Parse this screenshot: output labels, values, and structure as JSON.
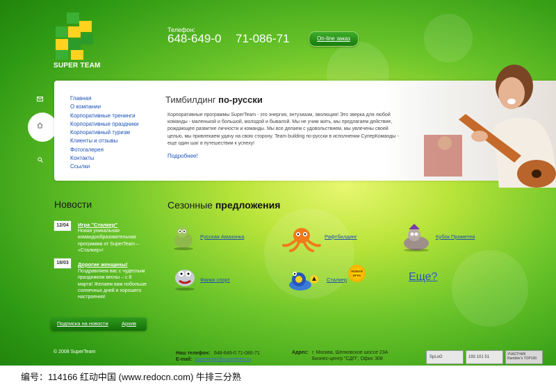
{
  "header": {
    "brand": "SUPER TEAM",
    "phone_label": "Телефон:",
    "phone_1": "648-649-0",
    "phone_2": "71-086-71",
    "online_order": "On-line заказ"
  },
  "nav": {
    "items": [
      "Главная",
      "О компании",
      "Корпоративные тренинги",
      "Корпоративные праздники",
      "Корпоративный туризм",
      "Клиенты и отзывы",
      "Фотогалерея",
      "Контакты",
      "Ссылки"
    ]
  },
  "intro": {
    "title_plain": "Тимбилдинг ",
    "title_bold": "по-русски",
    "text": "Корпоративные программы SuperTeam - это энергия, энтузиазм, эволюция! Это зверка для любой команды - маленькой и большой, молодой и бывалой. Мы не учим жить, мы предлагаем действие, рождающее развитие личности и команды. Мы все делаем с удовольствием, мы увлечены своей целью, мы привлекаем удачу на свою сторону. Team building по-русски в исполнении СуперКоманды - еще один шаг в путешествии к успеху!",
    "more": "Подробнее!"
  },
  "news": {
    "title": "Новости",
    "items": [
      {
        "date": "12/04",
        "link": "Игра \"Сталкер\"",
        "body": "Новая уникальная командообразовательная программа от SuperTeam – «Сталкер»!"
      },
      {
        "date": "18/03",
        "link": "Дорогие женщины!",
        "body": "Поздравляем вас с чудесным праздником весны – с 8 марта! Желаем вам побольше солнечных дней и хорошего настроения!"
      }
    ],
    "subscribe": "Подписка на новости",
    "archive": "Архив"
  },
  "offers": {
    "title_plain": "Сезонные ",
    "title_bold": "предложения",
    "items": [
      "Русская Амазонка",
      "Рафтбилдинг",
      "Кубок Прометея",
      "Фанки спорт",
      "Сталкер"
    ],
    "badge": "НОВАЯ ИГРА",
    "more": "Еще?"
  },
  "footer": {
    "copyright": "© 2008 SuperTeam",
    "phone_label": "Наш телефон:",
    "phones": "648-649-0    71-086-71",
    "email_label": "E-mail:",
    "email": "superteam@superteam.ru",
    "address_label": "Адрес:",
    "address_1": "г. Москва, Шелковское шоссе 23А",
    "address_2": "Бизнес-центр \"СДП\", Офис 308",
    "counter_1": "SpLoG",
    "counter_2": "193 101 51",
    "counter_3": "УЧАСТНИК Rambler's TOP100"
  },
  "watermark": "编号：114166    红动中国 (www.redocn.com)  牛排三分熟"
}
